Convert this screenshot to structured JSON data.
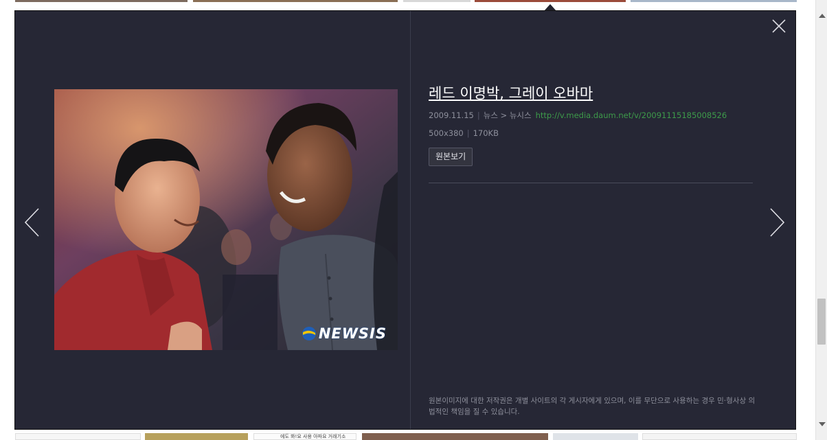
{
  "viewer": {
    "title": "레드 이명박, 그레이 오바마",
    "date": "2009.11.15",
    "category": "뉴스 > 뉴시스",
    "source_url": "http://v.media.daum.net/v/20091115185008526",
    "dimensions": "500x380",
    "file_size": "170KB",
    "original_button": "원본보기",
    "copyright_notice": "원본이미지에 대한 저작권은 개별 사이트의 각 게시자에게 있으며, 이를 무단으로 사용하는 경우 민·형사상 의 법적인 책임을 질 수 있습니다.",
    "watermark": "NEWSIS"
  },
  "icons": {
    "close": "close-icon",
    "prev": "chevron-left-icon",
    "next": "chevron-right-icon"
  },
  "thumbnails": {
    "bottom_caption_3": "에도 봐!요 사용 아파요 거래기소"
  },
  "colors": {
    "panel_bg": "#262735",
    "link_green": "#3d9b4a",
    "title": "#ffffff"
  }
}
